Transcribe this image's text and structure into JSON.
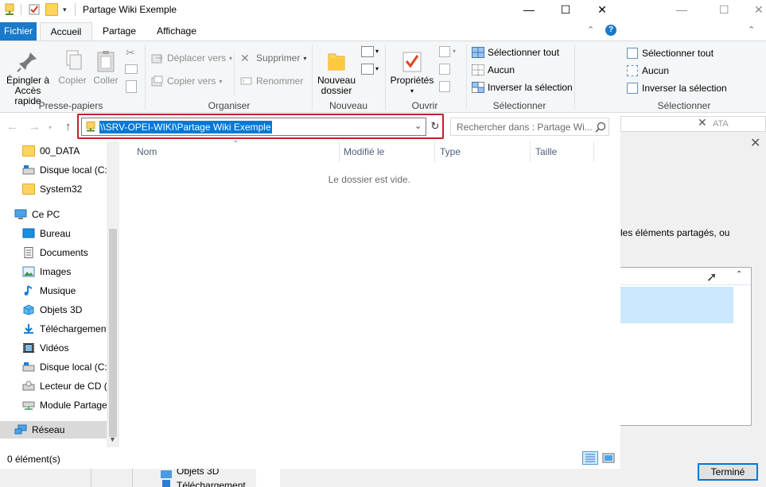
{
  "window": {
    "title": "Partage Wiki Exemple",
    "minimize": "—",
    "maximize": "☐",
    "close": "✕"
  },
  "tabs": {
    "fichier": "Fichier",
    "accueil": "Accueil",
    "partage": "Partage",
    "affichage": "Affichage"
  },
  "ribbon": {
    "pin_line1": "Épingler à",
    "pin_line2": "Accès rapide",
    "copy": "Copier",
    "paste": "Coller",
    "group_clipboard": "Presse-papiers",
    "move_to": "Déplacer vers",
    "copy_to": "Copier vers",
    "delete": "Supprimer",
    "rename": "Renommer",
    "group_organize": "Organiser",
    "new_folder_line1": "Nouveau",
    "new_folder_line2": "dossier",
    "group_new": "Nouveau",
    "properties": "Propriétés",
    "group_open": "Ouvrir",
    "select_all": "Sélectionner tout",
    "select_none": "Aucun",
    "invert_selection": "Inverser la sélection",
    "group_select": "Sélectionner"
  },
  "address": {
    "path": "\\\\SRV-OPEI-WIKI\\Partage Wiki Exemple",
    "search_placeholder": "Rechercher dans : Partage Wi..."
  },
  "navpane": [
    {
      "label": "00_DATA",
      "icon": "folder-icon"
    },
    {
      "label": "Disque local (C:)",
      "icon": "drive-icon"
    },
    {
      "label": "System32",
      "icon": "folder-icon"
    },
    {
      "label": "Ce PC",
      "icon": "computer-icon"
    },
    {
      "label": "Bureau",
      "icon": "desktop-icon"
    },
    {
      "label": "Documents",
      "icon": "documents-icon"
    },
    {
      "label": "Images",
      "icon": "images-icon"
    },
    {
      "label": "Musique",
      "icon": "music-icon"
    },
    {
      "label": "Objets 3D",
      "icon": "objects3d-icon"
    },
    {
      "label": "Téléchargements",
      "icon": "downloads-icon"
    },
    {
      "label": "Vidéos",
      "icon": "videos-icon"
    },
    {
      "label": "Disque local (C:)",
      "icon": "drive-icon"
    },
    {
      "label": "Lecteur de CD (D:)",
      "icon": "cd-drive-icon"
    },
    {
      "label": "Module Partage",
      "icon": "network-drive-icon"
    },
    {
      "label": "Réseau",
      "icon": "network-icon"
    }
  ],
  "columns": {
    "name": "Nom",
    "modified": "Modifié le",
    "type": "Type",
    "size": "Taille"
  },
  "filelist": {
    "empty_message": "Le dossier est vide."
  },
  "status": {
    "count": "0 élément(s)"
  },
  "background": {
    "select_all": "Sélectionner tout",
    "select_none": "Aucun",
    "invert_selection": "Inverser la sélection",
    "group_select": "Sélectionner",
    "address_fragment": "ATA",
    "dialog_text": "les éléments partagés, ou",
    "done_button": "Terminé",
    "strip_item1": "Objets 3D",
    "strip_item2": "Téléchargement"
  },
  "colors": {
    "accent": "#1979ca",
    "selection": "#0078d7",
    "highlight_border": "#c0202a",
    "folder": "#ffd45c"
  }
}
